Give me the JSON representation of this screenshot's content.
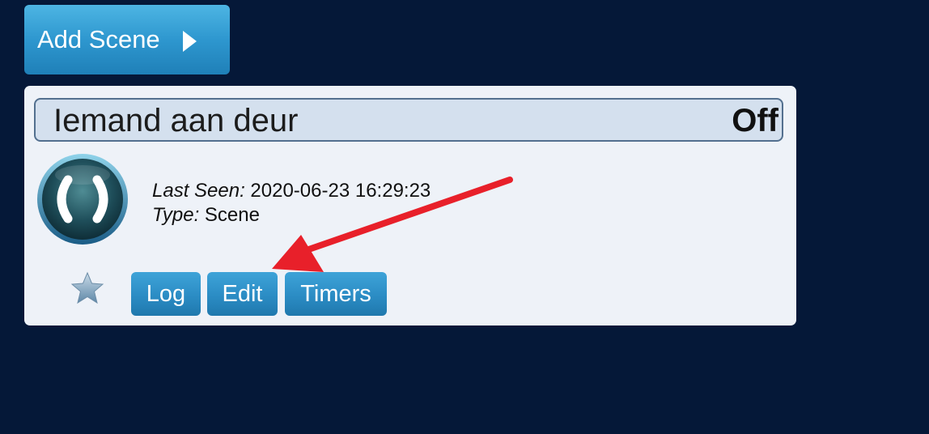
{
  "toolbar": {
    "add_scene_label": "Add Scene"
  },
  "scene": {
    "name": "Iemand aan deur",
    "status": "Off",
    "last_seen_label": "Last Seen:",
    "last_seen_value": " 2020-06-23 16:29:23",
    "type_label": "Type:",
    "type_value": " Scene",
    "buttons": {
      "log": "Log",
      "edit": "Edit",
      "timers": "Timers"
    }
  },
  "colors": {
    "background": "#051838",
    "card": "#eef2f8",
    "button_blue": "#2b8cc4",
    "annotation_arrow": "#e8202a"
  },
  "icons": {
    "scene": "scene-icon",
    "favorite": "star-icon",
    "play": "triangle-right-icon"
  }
}
